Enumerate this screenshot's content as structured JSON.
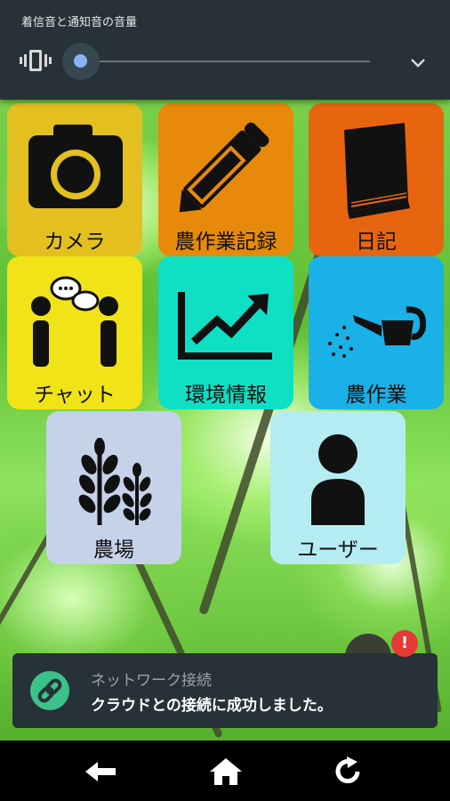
{
  "volume_panel": {
    "title": "着信音と通知音の音量",
    "level": 0.0,
    "icons": [
      "vibrate-icon",
      "chevron-down-icon"
    ]
  },
  "tiles": [
    {
      "label": "カメラ",
      "color": "#e3c020",
      "icon": "camera-icon"
    },
    {
      "label": "農作業記録",
      "color": "#e78a0c",
      "icon": "pencil-icon"
    },
    {
      "label": "日記",
      "color": "#e8650f",
      "icon": "book-icon"
    },
    {
      "label": "チャット",
      "color": "#f0e317",
      "icon": "chat-icon"
    },
    {
      "label": "環境情報",
      "color": "#0ee0c4",
      "icon": "chart-icon"
    },
    {
      "label": "農作業",
      "color": "#1ab0e8",
      "icon": "watering-can-icon"
    },
    {
      "label": "農場",
      "color": "#c5d2ea",
      "icon": "wheat-icon"
    },
    {
      "label": "ユーザー",
      "color": "#b4ecf2",
      "icon": "user-icon"
    }
  ],
  "snackbar": {
    "title": "ネットワーク接続",
    "message": "クラウドとの接続に成功しました。",
    "icon": "link-icon",
    "accent": "#3cc18a"
  },
  "badge": {
    "text": "!",
    "color": "#e53935"
  },
  "nav": {
    "buttons": [
      "back-icon",
      "home-icon",
      "refresh-icon"
    ]
  }
}
